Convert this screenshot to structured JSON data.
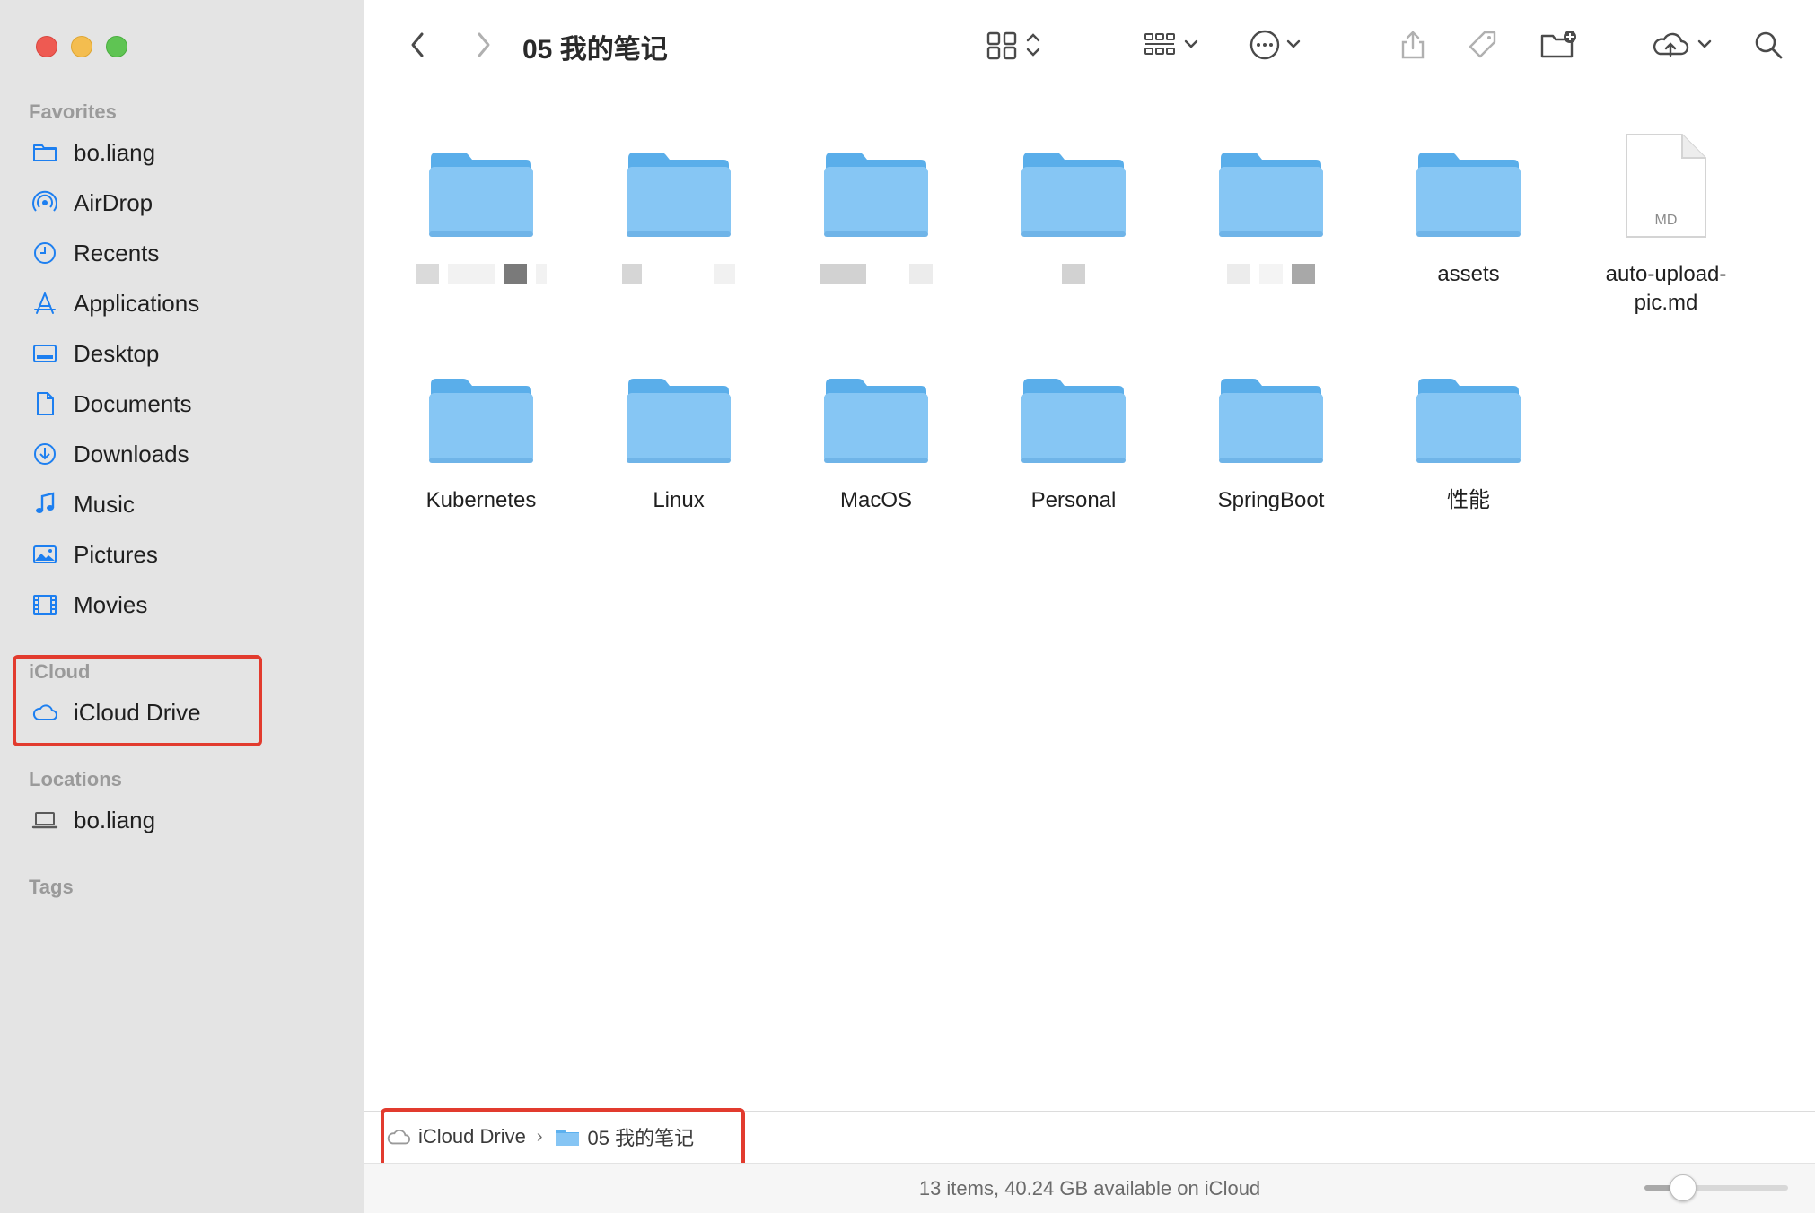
{
  "window": {
    "title": "05 我的笔记"
  },
  "sidebar": {
    "favorites_title": "Favorites",
    "favorites": [
      {
        "label": "bo.liang",
        "icon": "folder-icon"
      },
      {
        "label": "AirDrop",
        "icon": "airdrop-icon"
      },
      {
        "label": "Recents",
        "icon": "clock-icon"
      },
      {
        "label": "Applications",
        "icon": "applications-icon"
      },
      {
        "label": "Desktop",
        "icon": "desktop-icon"
      },
      {
        "label": "Documents",
        "icon": "document-icon"
      },
      {
        "label": "Downloads",
        "icon": "download-icon"
      },
      {
        "label": "Music",
        "icon": "music-note-icon"
      },
      {
        "label": "Pictures",
        "icon": "photo-icon"
      },
      {
        "label": "Movies",
        "icon": "film-icon"
      }
    ],
    "icloud_title": "iCloud",
    "icloud": [
      {
        "label": "iCloud Drive",
        "icon": "cloud-icon"
      }
    ],
    "locations_title": "Locations",
    "locations": [
      {
        "label": "bo.liang",
        "icon": "laptop-icon"
      }
    ],
    "tags_title": "Tags"
  },
  "items": [
    {
      "label": "",
      "kind": "folder",
      "redacted": true
    },
    {
      "label": "",
      "kind": "folder",
      "redacted": true
    },
    {
      "label": "",
      "kind": "folder",
      "redacted": true
    },
    {
      "label": "",
      "kind": "folder",
      "redacted": true
    },
    {
      "label": "",
      "kind": "folder",
      "redacted": true
    },
    {
      "label": "assets",
      "kind": "folder"
    },
    {
      "label": "auto-upload-\npic.md",
      "kind": "file",
      "badge": "MD"
    },
    {
      "label": "Kubernetes",
      "kind": "folder"
    },
    {
      "label": "Linux",
      "kind": "folder"
    },
    {
      "label": "MacOS",
      "kind": "folder"
    },
    {
      "label": "Personal",
      "kind": "folder"
    },
    {
      "label": "SpringBoot",
      "kind": "folder"
    },
    {
      "label": "性能",
      "kind": "folder"
    }
  ],
  "pathbar": {
    "root": "iCloud Drive",
    "current": "05 我的笔记"
  },
  "status": {
    "text": "13 items, 40.24 GB available on iCloud",
    "icon_size_slider": 0.2
  },
  "colors": {
    "sidebar_bg": "#e4e4e4",
    "folder_blue": "#7ec1f2",
    "highlight_red": "#e23b2e",
    "accent_blue": "#1d7ff0"
  }
}
